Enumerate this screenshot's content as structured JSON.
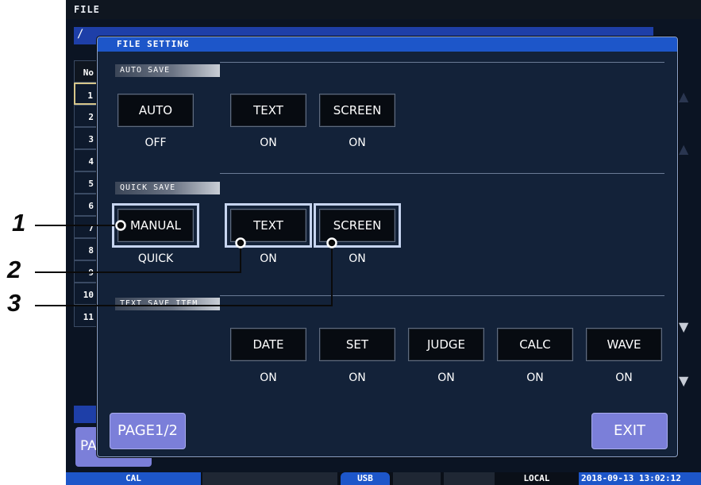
{
  "screen": {
    "title": "FILE",
    "path": "/",
    "list_header": "No",
    "list_numbers": [
      "1",
      "2",
      "3",
      "4",
      "5",
      "6",
      "7",
      "8",
      "9",
      "10",
      "11"
    ],
    "page_button_fragment": "PA"
  },
  "dialog": {
    "title": "FILE SETTING",
    "auto_save": {
      "label": "AUTO SAVE",
      "buttons": [
        {
          "label": "AUTO",
          "value": "OFF"
        },
        {
          "label": "TEXT",
          "value": "ON"
        },
        {
          "label": "SCREEN",
          "value": "ON"
        }
      ]
    },
    "quick_save": {
      "label": "QUICK SAVE",
      "buttons": [
        {
          "label": "MANUAL",
          "value": "QUICK"
        },
        {
          "label": "TEXT",
          "value": "ON"
        },
        {
          "label": "SCREEN",
          "value": "ON"
        }
      ]
    },
    "text_save_item": {
      "label": "TEXT SAVE ITEM",
      "buttons": [
        {
          "label": "DATE",
          "value": "ON"
        },
        {
          "label": "SET",
          "value": "ON"
        },
        {
          "label": "JUDGE",
          "value": "ON"
        },
        {
          "label": "CALC",
          "value": "ON"
        },
        {
          "label": "WAVE",
          "value": "ON"
        }
      ]
    },
    "page_button": "PAGE1/2",
    "exit_button": "EXIT"
  },
  "status_bar": {
    "cal": "CAL",
    "usb": "USB",
    "local": "LOCAL",
    "datetime": "2018-09-13 13:02:12"
  },
  "callouts": [
    "1",
    "2",
    "3"
  ],
  "colors": {
    "screen_bg": "#0b1423",
    "dialog_bg": "#132239",
    "title_bar": "#1d56c9",
    "button_bg": "#070b11",
    "purple_button": "#7b7fd9",
    "highlight": "#c6d4ef"
  },
  "icons": {
    "scroll_up": "triangle-up-icon",
    "scroll_down": "triangle-down-icon",
    "callout_dot": "dot-icon"
  }
}
